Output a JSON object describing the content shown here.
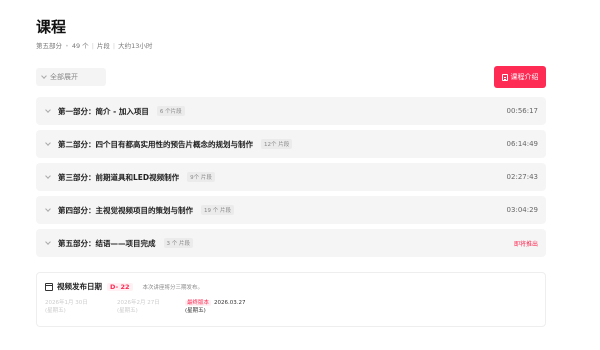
{
  "page": {
    "title": "课程"
  },
  "meta": {
    "part": "第五部分",
    "count": "49 个",
    "unit": "片段",
    "duration": "大约13小时"
  },
  "toolbar": {
    "expand_label": "全部展开",
    "intro_label": "课程介绍"
  },
  "sections": [
    {
      "title": "第一部分：简介 - 加入项目",
      "count": "6 个片段",
      "duration": "00:56:17"
    },
    {
      "title": "第二部分：四个目有都高实用性的预告片概念的规划与制作",
      "count": "12个 片段",
      "duration": "06:14:49"
    },
    {
      "title": "第三部分：前期道具和LED视频制作",
      "count": "9个 片段",
      "duration": "02:27:43"
    },
    {
      "title": "第四部分：主视觉视频项目的策划与制作",
      "count": "19 个 片段",
      "duration": "03:04:29"
    },
    {
      "title": "第五部分：结语——项目完成",
      "count": "3 个 片段",
      "duration": "即将推出"
    }
  ],
  "release": {
    "title": "视频发布日期",
    "countdown": "D- 22",
    "note": "本次讲座将分三期发布。",
    "items": [
      {
        "badge": "",
        "date": "2026年1月 30日",
        "weekday": "(星期五)"
      },
      {
        "badge": "",
        "date": "2026年2月 27日",
        "weekday": "(星期五)"
      },
      {
        "badge": "最终版本",
        "date": "2026.03.27",
        "weekday": "(星期五)"
      }
    ]
  },
  "colors": {
    "accent": "#fe2c55",
    "section_bg": "#f5f5f5"
  }
}
